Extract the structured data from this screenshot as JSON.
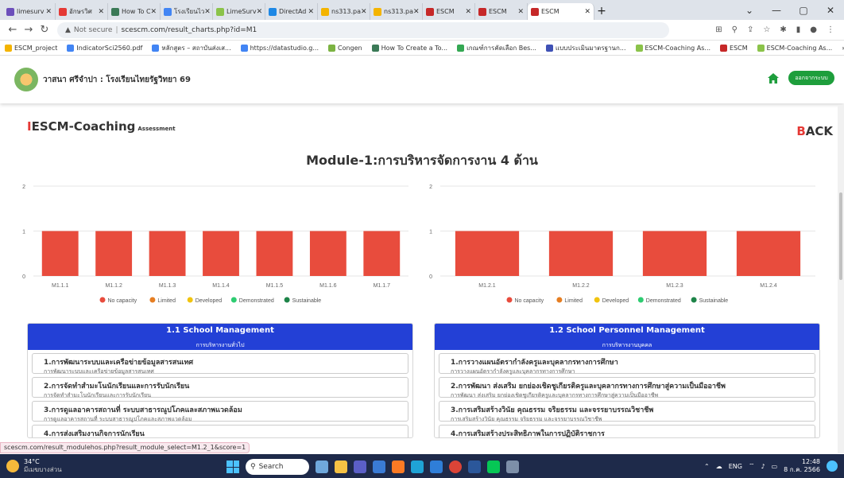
{
  "browser": {
    "tabs": [
      {
        "label": "limesurv",
        "color": "#6c4fbb"
      },
      {
        "label": "อักษรวิศ",
        "color": "#e53935"
      },
      {
        "label": "How To C",
        "color": "#3b7a57"
      },
      {
        "label": "โรงเรียนไว",
        "color": "#4285f4"
      },
      {
        "label": "LimeSurv",
        "color": "#8bc34a"
      },
      {
        "label": "DirectAd",
        "color": "#1e88e5"
      },
      {
        "label": "ns313.pa",
        "color": "#f4b400"
      },
      {
        "label": "ns313.pa",
        "color": "#f4b400"
      },
      {
        "label": "ESCM",
        "color": "#c62828"
      },
      {
        "label": "ESCM",
        "color": "#c62828"
      },
      {
        "label": "ESCM",
        "color": "#c62828"
      }
    ],
    "url_security": "Not secure",
    "url": "scescm.com/result_charts.php?id=M1",
    "bookmarks": [
      {
        "label": "ESCM_project",
        "color": "#f4b400"
      },
      {
        "label": "IndicatorSci2560.pdf",
        "color": "#4285f4"
      },
      {
        "label": "หลักสูตร – สถาบันส่งเส...",
        "color": "#4285f4"
      },
      {
        "label": "https://datastudio.g...",
        "color": "#4285f4"
      },
      {
        "label": "Congen",
        "color": "#7cb342"
      },
      {
        "label": "How To Create a To...",
        "color": "#3b7a57"
      },
      {
        "label": "เกณฑ์การคัดเลือก Bes...",
        "color": "#34a853"
      },
      {
        "label": "แบบประเมินมาตรฐานก...",
        "color": "#3f51b5"
      },
      {
        "label": "ESCM-Coaching As...",
        "color": "#8bc34a"
      },
      {
        "label": "ESCM",
        "color": "#c62828"
      },
      {
        "label": "ESCM-Coaching As...",
        "color": "#8bc34a"
      }
    ],
    "status_url": "scescm.com/result_modulehos.php?result_module_select=M1.2_1&score=1"
  },
  "app": {
    "school": "วาสนา ศรีจำปา : โรงเรียนไทยรัฐวิทยา 69",
    "logout": "ออกจากระบบ",
    "brand": "ESCM-Coaching",
    "brand_sub": "Assessment",
    "back_first": "B",
    "back_rest": "ACK",
    "page_title": "Module-1:การบริหารจัดการงาน 4 ด้าน"
  },
  "legend": [
    {
      "label": "No capacity",
      "color": "#e84c3d"
    },
    {
      "label": "Limited",
      "color": "#e67e22"
    },
    {
      "label": "Developed",
      "color": "#f1c40f"
    },
    {
      "label": "Demonstrated",
      "color": "#2ecc71"
    },
    {
      "label": "Sustainable",
      "color": "#1e8449"
    }
  ],
  "chart_data": [
    {
      "type": "bar",
      "categories": [
        "M1.1.1",
        "M1.1.2",
        "M1.1.3",
        "M1.1.4",
        "M1.1.5",
        "M1.1.6",
        "M1.1.7"
      ],
      "values": [
        1,
        1,
        1,
        1,
        1,
        1,
        1
      ],
      "ylim": [
        0,
        2
      ],
      "yticks": [
        0,
        1,
        2
      ],
      "grid": true,
      "legend_position": "bottom"
    },
    {
      "type": "bar",
      "categories": [
        "M1.2.1",
        "M1.2.2",
        "M1.2.3",
        "M1.2.4"
      ],
      "values": [
        1,
        1,
        1,
        1
      ],
      "ylim": [
        0,
        2
      ],
      "yticks": [
        0,
        1,
        2
      ],
      "grid": true,
      "legend_position": "bottom"
    }
  ],
  "cards": [
    {
      "title": "1.1 School Management",
      "subtitle": "การบริหารงานทั่วไป",
      "items": [
        {
          "title": "1.การพัฒนาระบบและเครือข่ายข้อมูลสารสนเทศ",
          "sub": "การพัฒนาระบบและเครือข่ายข้อมูลสารสนเทศ"
        },
        {
          "title": "2.การจัดทำสำมะโนนักเรียนและการรับนักเรียน",
          "sub": "การจัดทำสำมะโนนักเรียนและการรับนักเรียน"
        },
        {
          "title": "3.การดูแลอาคารสถานที่ ระบบสาธารณูปโภคและสภาพแวดล้อม",
          "sub": "การดูแลอาคารสถานที่ ระบบสาธารณูปโภคและสภาพแวดล้อม"
        },
        {
          "title": "4.การส่งเสริมงานกิจการนักเรียน",
          "sub": ""
        }
      ]
    },
    {
      "title": "1.2 School Personnel Management",
      "subtitle": "การบริหารงานบุคคล",
      "items": [
        {
          "title": "1.การวางแผนอัตรากำลังครูและบุคลากรทางการศึกษา",
          "sub": "การวางแผนอัตรากำลังครูและบุคลากรทางการศึกษา"
        },
        {
          "title": "2.การพัฒนา ส่งเสริม ยกย่องเชิดชูเกียรติครูและบุคลากรทางการศึกษาสู่ความเป็นมืออาชีพ",
          "sub": "การพัฒนา ส่งเสริม ยกย่องเชิดชูเกียรติครูและบุคลากรทางการศึกษาสู่ความเป็นมืออาชีพ"
        },
        {
          "title": "3.การเสริมสร้างวินัย คุณธรรม จริยธรรม และจรรยาบรรณวิชาชีพ",
          "sub": "การเสริมสร้างวินัย คุณธรรม จริยธรรม และจรรยาบรรณวิชาชีพ"
        },
        {
          "title": "4.การเสริมสร้างประสิทธิภาพในการปฏิบัติราชการ",
          "sub": ""
        }
      ]
    }
  ],
  "taskbar": {
    "temp": "34°C",
    "weather": "มีเมฆบางส่วน",
    "search": "Search",
    "lang": "ENG",
    "time": "12:48",
    "date": "8 ก.ค. 2566"
  }
}
